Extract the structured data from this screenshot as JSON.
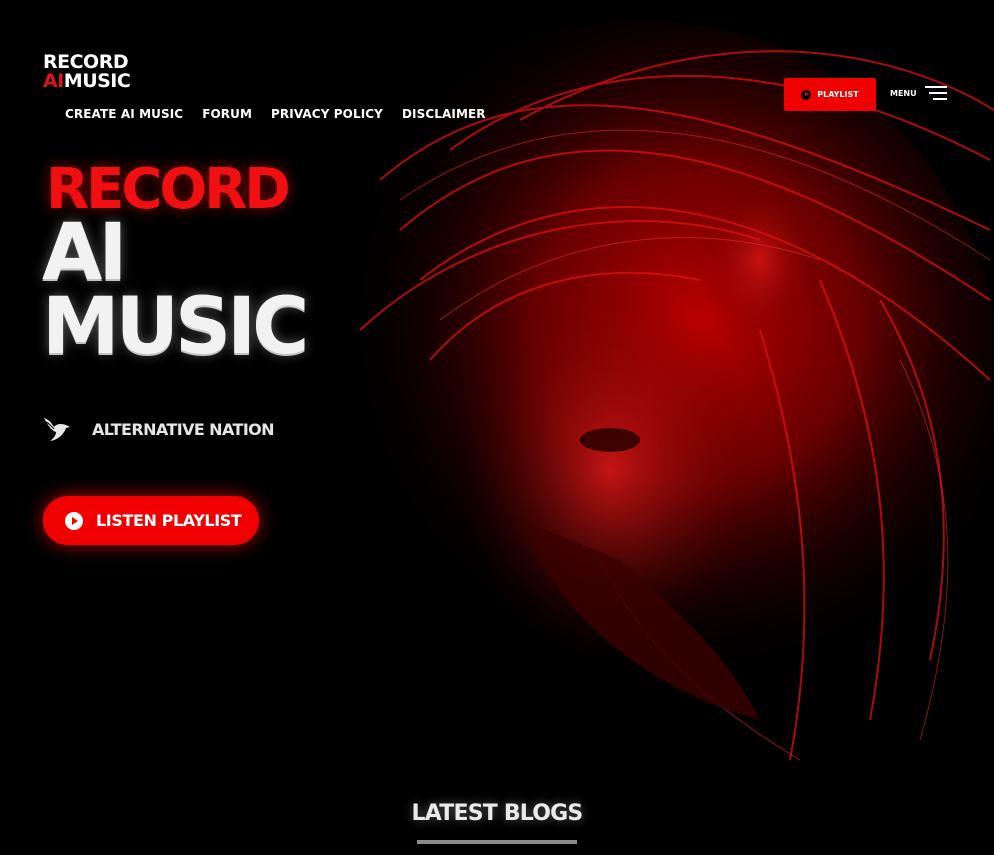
{
  "logo": {
    "line1": "RECORD",
    "line2_red": "AI",
    "line2_white": "MUSIC"
  },
  "nav": {
    "items": [
      "CREATE AI MUSIC",
      "FORUM",
      "PRIVACY POLICY",
      "DISCLAIMER"
    ]
  },
  "header": {
    "playlist_label": "PLAYLIST",
    "menu_label": "MENU"
  },
  "hero": {
    "title_line1": "RECORD",
    "title_line2": "AI",
    "title_line3": "MUSIC",
    "subtitle": "ALTERNATIVE NATION",
    "cta_label": "LISTEN PLAYLIST"
  },
  "section": {
    "latest_title": "LATEST BLOGS"
  },
  "colors": {
    "accent": "#f00000",
    "background": "#000000",
    "text": "#ffffff"
  },
  "icons": [
    "play-icon",
    "hamburger-icon",
    "bird-icon"
  ]
}
